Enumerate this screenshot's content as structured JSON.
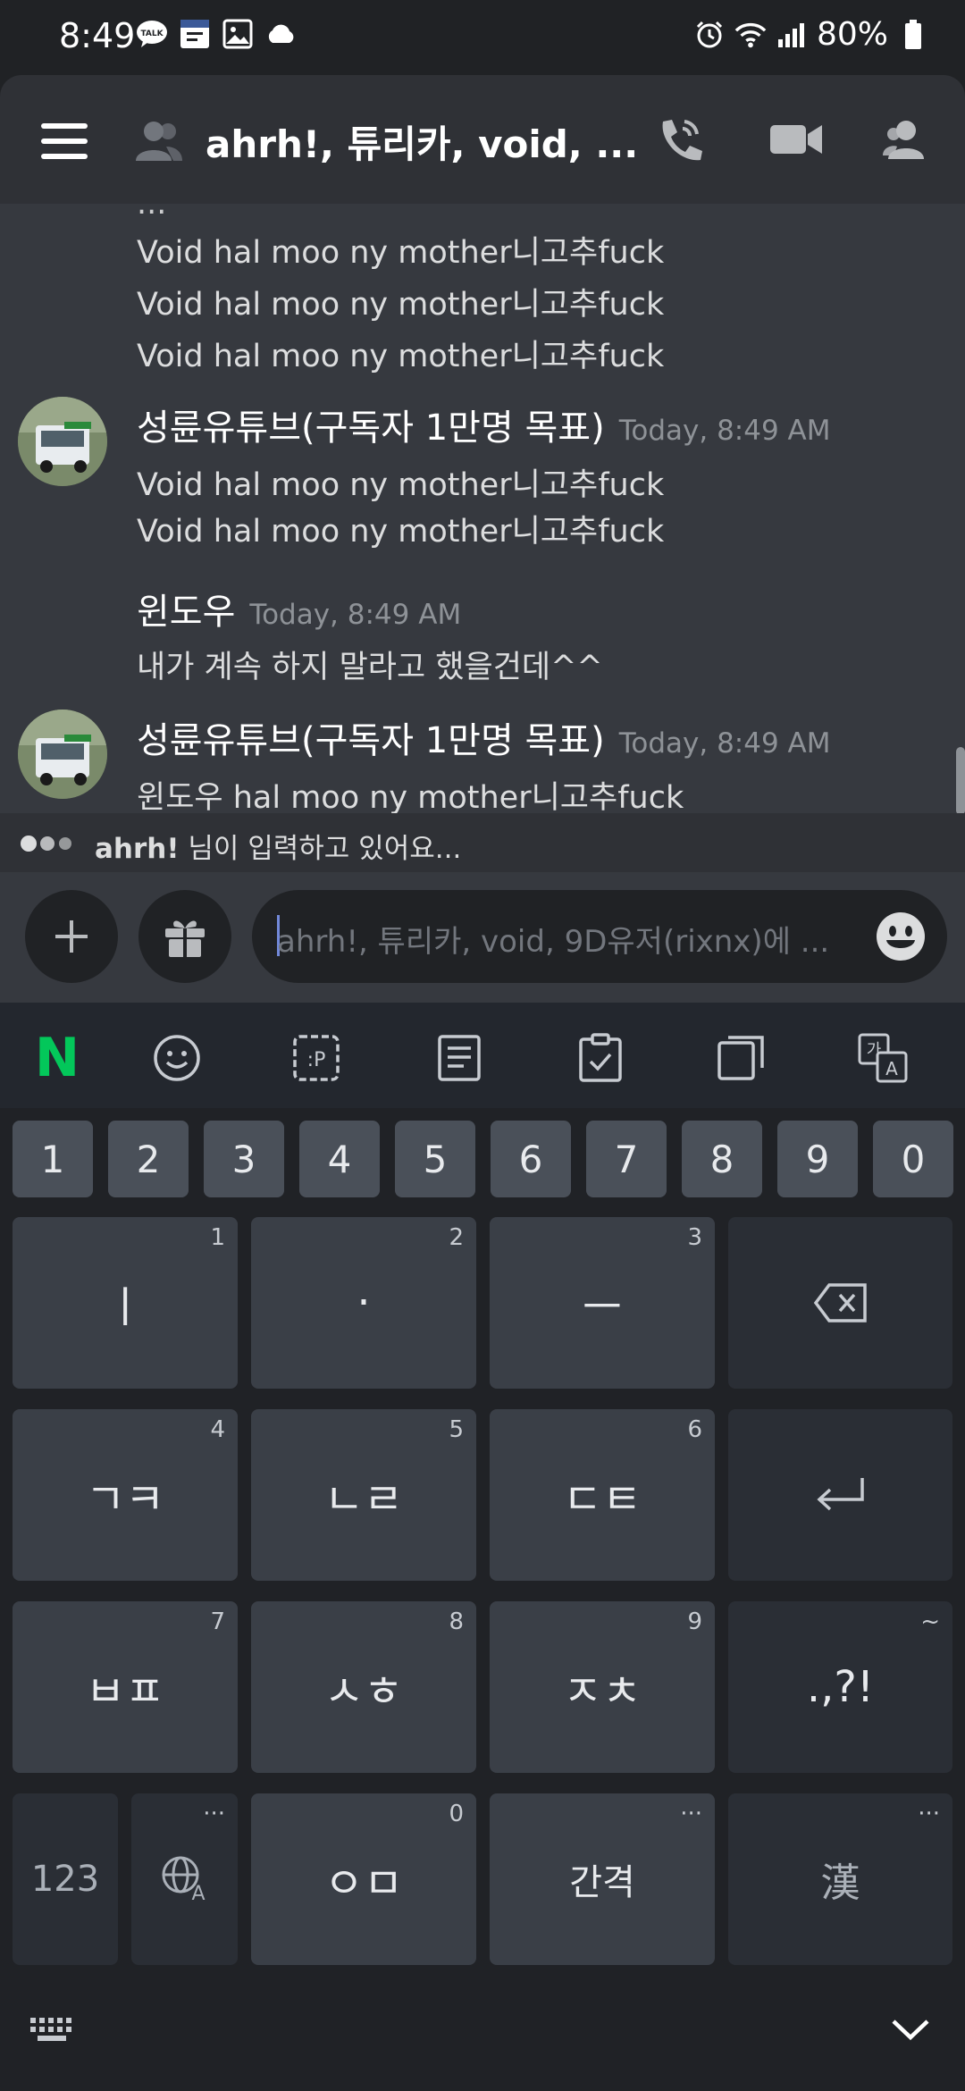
{
  "status_bar": {
    "time": "8:49",
    "battery": "80%",
    "left_icons": [
      "talk-icon",
      "calendar-icon",
      "gallery-icon",
      "cloud-icon"
    ],
    "talk_badge": "TALK"
  },
  "header": {
    "title": "ahrh!, 튜리카, void, ..."
  },
  "messages": {
    "continued_lines": [
      "Void hal moo ny mother니고추fuck",
      "Void hal moo ny mother니고추fuck",
      "Void hal moo ny mother니고추fuck"
    ],
    "group1": {
      "author": "성륜유튜브(구독자 1만명 목표)",
      "timestamp": "Today, 8:49 AM",
      "lines": [
        "Void hal moo ny mother니고추fuck",
        "Void hal moo ny mother니고추fuck"
      ]
    },
    "group2": {
      "author": "윈도우",
      "timestamp": "Today, 8:49 AM",
      "lines": [
        "내가 계속 하지 말라고 했을건데^^"
      ]
    },
    "group3": {
      "author": "성륜유튜브(구독자 1만명 목표)",
      "timestamp": "Today, 8:49 AM",
      "lines": [
        "윈도우 hal moo ny mother니고추fuck"
      ]
    }
  },
  "typing": {
    "user": "ahrh!",
    "text": "님이 입력하고 있어요..."
  },
  "composer": {
    "placeholder": "ahrh!, 튜리카, void, 9D유저(rixnx)에 ..."
  },
  "keyboard": {
    "toolbar_brand": "N",
    "number_row": [
      "1",
      "2",
      "3",
      "4",
      "5",
      "6",
      "7",
      "8",
      "9",
      "0"
    ],
    "row1": {
      "k1": "ㅣ",
      "k1_hint": "1",
      "k2": "·",
      "k2_hint": "2",
      "k3": "ㅡ",
      "k3_hint": "3"
    },
    "row2": {
      "k1": "ㄱㅋ",
      "k1_hint": "4",
      "k2": "ㄴㄹ",
      "k2_hint": "5",
      "k3": "ㄷㅌ",
      "k3_hint": "6"
    },
    "row3": {
      "k1": "ㅂㅍ",
      "k1_hint": "7",
      "k2": "ㅅㅎ",
      "k2_hint": "8",
      "k3": "ㅈㅊ",
      "k3_hint": "9",
      "k4": ".,?!",
      "k4_hint": "~"
    },
    "row4": {
      "num": "123",
      "k2": "ㅇㅁ",
      "k2_hint": "0",
      "space": "간격",
      "hanja": "漢",
      "more": "···"
    }
  },
  "colors": {
    "chat_bg": "#36393f",
    "header_bg": "#2f3136",
    "accent": "#7289da"
  }
}
